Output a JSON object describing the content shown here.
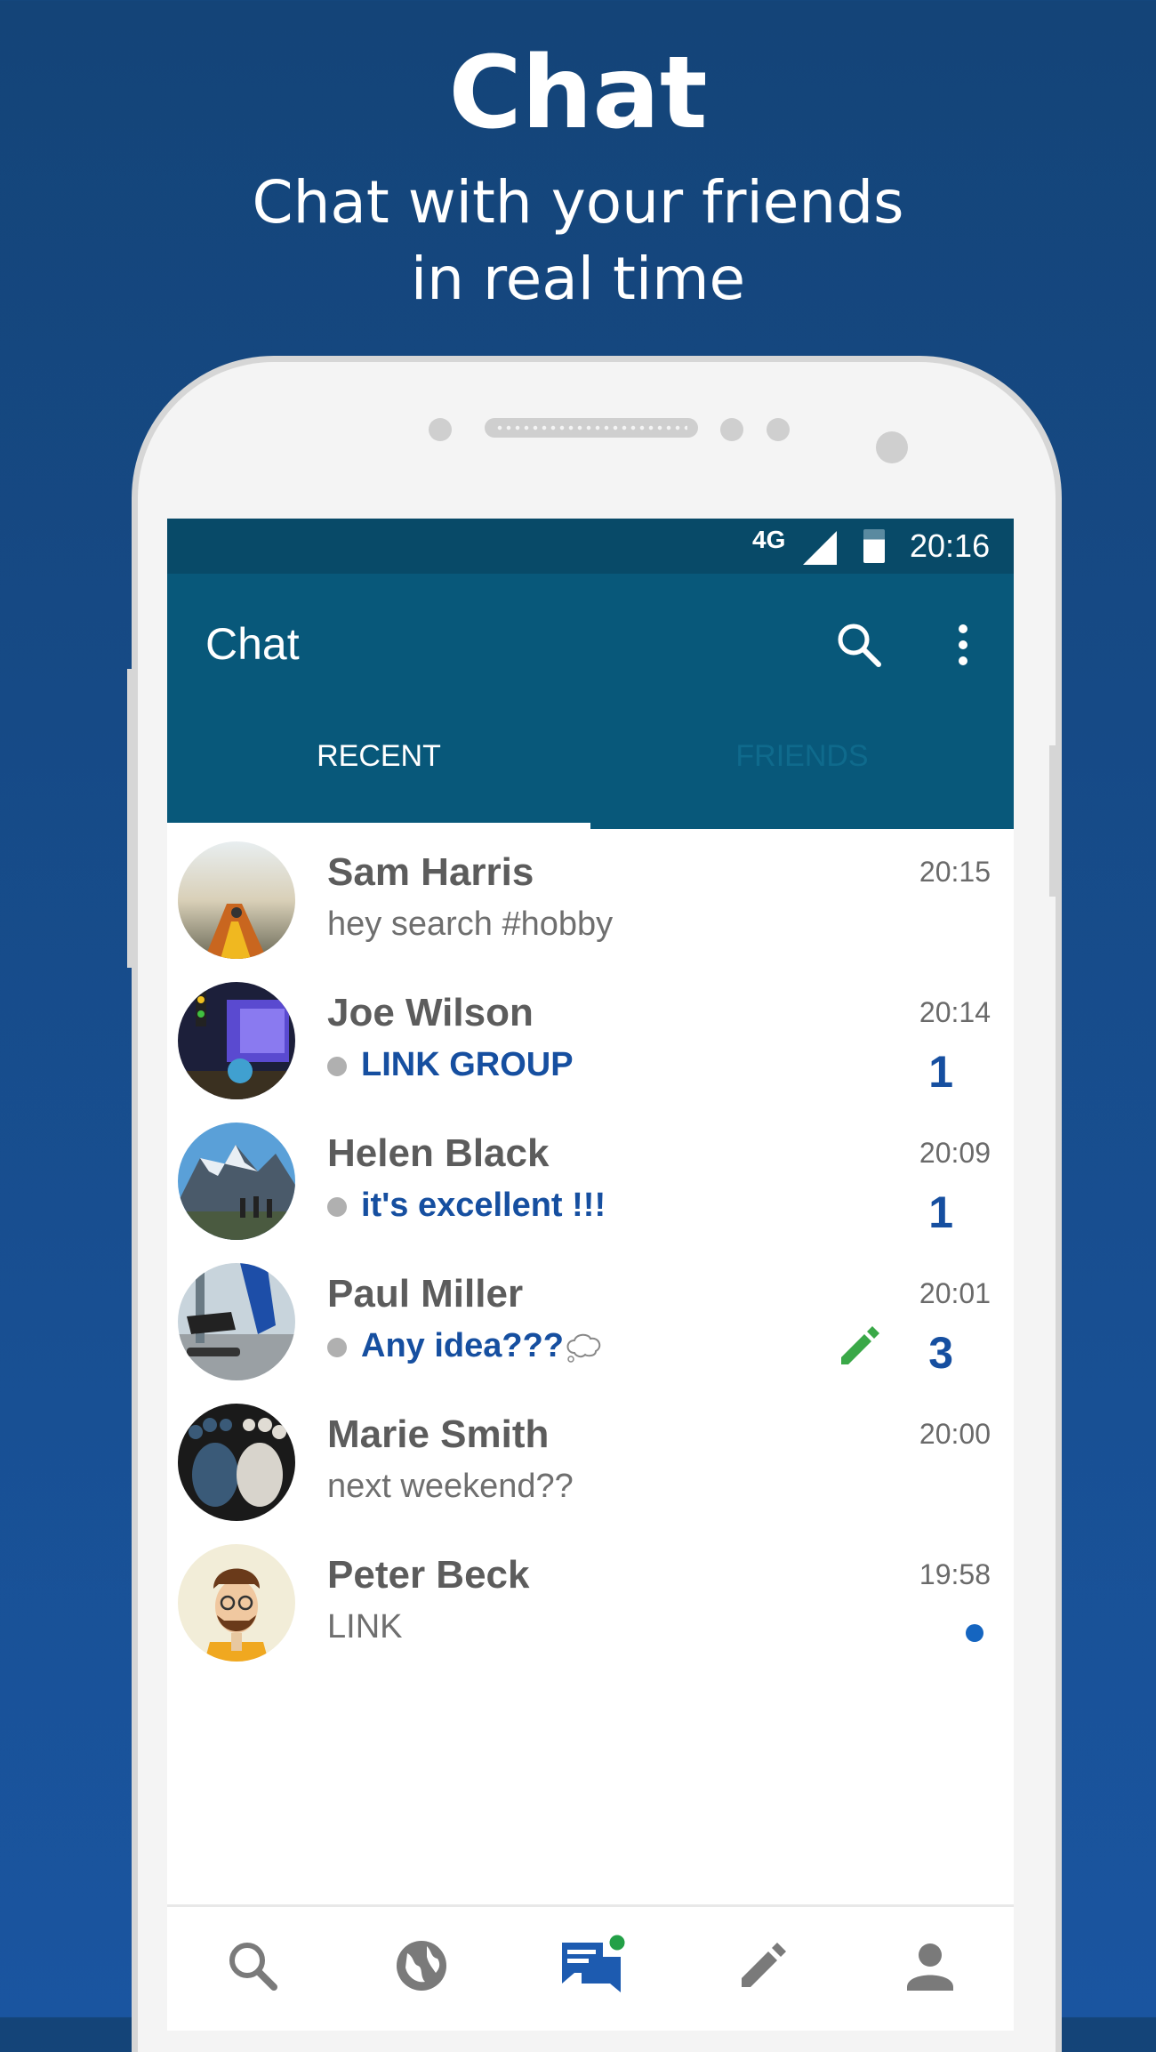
{
  "promo": {
    "headline": "Chat",
    "subline_1": "Chat with your friends",
    "subline_2": "in real time"
  },
  "statusbar": {
    "network": "4G",
    "time": "20:16"
  },
  "appbar": {
    "title": "Chat",
    "tabs": [
      {
        "label": "RECENT",
        "selected": true
      },
      {
        "label": "FRIENDS",
        "selected": false
      }
    ]
  },
  "colors": {
    "appbar": "#08587a",
    "statusbar": "#084a68",
    "accent": "#164fa0",
    "background": "#144478",
    "online": "#23a047"
  },
  "conversations": [
    {
      "name": "Sam Harris",
      "preview": "hey search #hobby",
      "time": "20:15",
      "unread": "",
      "avatar": "kayak-photo"
    },
    {
      "name": "Joe Wilson",
      "preview": "LINK GROUP",
      "time": "20:14",
      "unread": "1",
      "avatar": "city-night-photo"
    },
    {
      "name": "Helen Black",
      "preview": "it's excellent !!!",
      "time": "20:09",
      "unread": "1",
      "avatar": "mountains-photo"
    },
    {
      "name": "Paul Miller",
      "preview": "Any idea???",
      "time": "20:01",
      "unread": "3",
      "typing": true,
      "avatar": "skateboard-photo"
    },
    {
      "name": "Marie Smith",
      "preview": "next weekend??",
      "time": "20:00",
      "unread": "",
      "avatar": "pebble-feet-photo"
    },
    {
      "name": "Peter Beck",
      "preview": "LINK",
      "time": "19:58",
      "unread": "",
      "new_dot": true,
      "avatar": "hipster-cartoon"
    }
  ],
  "bottom_nav": [
    {
      "icon": "search-icon"
    },
    {
      "icon": "globe-icon"
    },
    {
      "icon": "chat-icon",
      "active": true
    },
    {
      "icon": "pencil-icon"
    },
    {
      "icon": "person-icon"
    }
  ]
}
